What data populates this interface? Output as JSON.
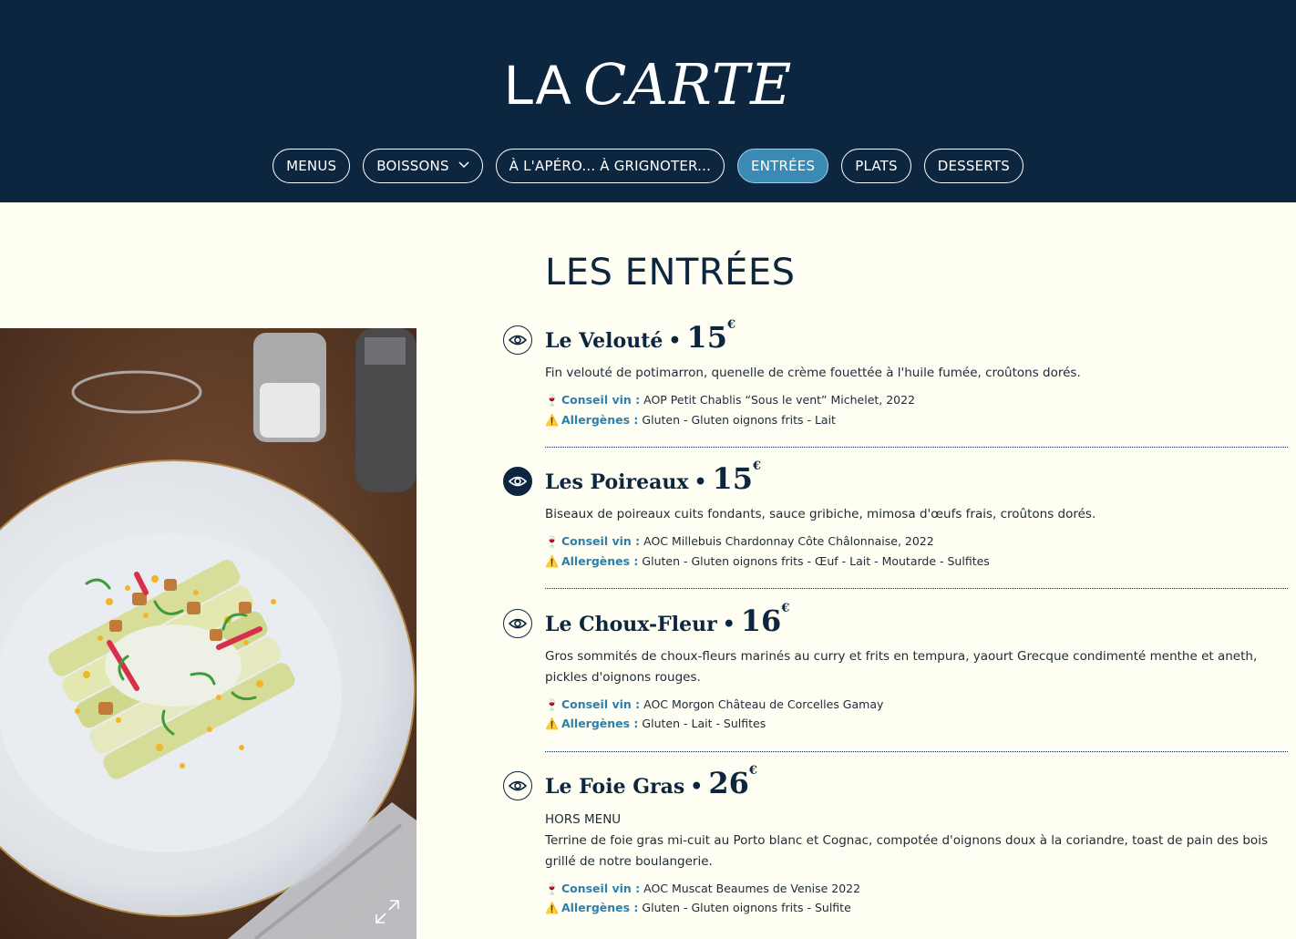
{
  "header": {
    "title_la": "LA",
    "title_carte": "CARTE",
    "nav": [
      {
        "label": "MENUS"
      },
      {
        "label": "BOISSONS"
      },
      {
        "label": "À L'APÉRO... À GRIGNOTER..."
      },
      {
        "label": "ENTRÉES"
      },
      {
        "label": "PLATS"
      },
      {
        "label": "DESSERTS"
      }
    ]
  },
  "section_title": "LES ENTRÉES",
  "labels": {
    "wine": "Conseil vin :",
    "allergens": "Allergènes :"
  },
  "dishes": [
    {
      "name": "Le Velouté",
      "price": "15",
      "currency": "€",
      "desc": "Fin velouté de potimarron, quenelle de crème fouettée à l'huile fumée, croûtons dorés.",
      "wine": "AOP Petit Chablis “Sous le vent” Michelet, 2022",
      "allergens": "Gluten - Gluten oignons frits - Lait"
    },
    {
      "name": "Les Poireaux",
      "price": "15",
      "currency": "€",
      "desc": "Biseaux de poireaux cuits fondants, sauce gribiche, mimosa d'œufs frais, croûtons dorés.",
      "wine": "AOC Millebuis Chardonnay Côte Châlonnaise, 2022",
      "allergens": "Gluten - Gluten oignons frits - Œuf - Lait - Moutarde - Sulfites"
    },
    {
      "name": "Le Choux-Fleur",
      "price": "16",
      "currency": "€",
      "desc": "Gros sommités de choux-fleurs marinés au curry et frits en tempura, yaourt Grecque condimenté menthe et aneth, pickles d'oignons rouges.",
      "wine": "AOC Morgon Château de Corcelles Gamay",
      "allergens": "Gluten - Lait - Sulfites"
    },
    {
      "name": "Le Foie Gras",
      "price": "26",
      "currency": "€",
      "note": "HORS MENU",
      "desc": "Terrine de foie gras mi-cuit au Porto blanc et Cognac, compotée d'oignons doux à la coriandre, toast de pain des bois grillé de notre boulangerie.",
      "wine": "AOC Muscat Beaumes de Venise 2022",
      "allergens": "Gluten - Gluten oignons frits - Sulfite"
    }
  ],
  "colors": {
    "header_bg": "#0c2640",
    "active_pill": "#3a8ab4",
    "page_bg": "#fefef3",
    "label_blue": "#2f7fab"
  },
  "icons": {
    "dish_toggle": "eye-icon",
    "photo_zoom": "expand-icon",
    "wine": "wine-glass-icon",
    "allergen": "warning-icon"
  }
}
